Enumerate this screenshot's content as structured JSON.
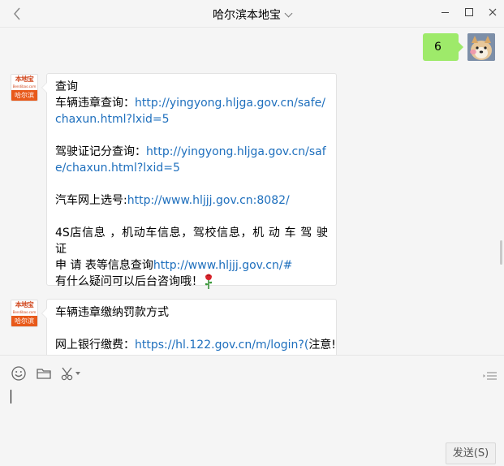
{
  "window": {
    "title": "哈尔滨本地宝"
  },
  "my_message": {
    "text": "6"
  },
  "bot": {
    "avatar_logo_text": "本地宝",
    "avatar_sub_text": "Bendibao.com",
    "avatar_city": "哈尔滨"
  },
  "messages": [
    {
      "heading": "查询",
      "violation_label": "车辆违章查询：",
      "violation_link": "http://yingyong.hljga.gov.cn/safe/chaxun.html?lxid=5",
      "license_label": "驾驶证记分查询：",
      "license_link": "http://yingyong.hljga.gov.cn/safe/chaxun.html?lxid=5",
      "plate_label": "汽车网上选号:",
      "plate_link": "http://www.hljjj.gov.cn:8082/",
      "info_line1": "4S店信息 ，机动车信息，驾校信息，机 动 车 驾 驶 证",
      "info_line2_text": "申 请 表等信息查询",
      "info_link": "http://www.hljjj.gov.cn/#",
      "closing": "有什么疑问可以后台咨询哦！"
    },
    {
      "heading": "车辆违章缴纳罚款方式",
      "bank_label": "网上银行缴费：",
      "bank_link": "https://hl.122.gov.cn/m/login?(",
      "bank_note": "注意!"
    }
  ],
  "composer": {
    "send_label": "发送(S)"
  },
  "icons": {
    "back": "chevron-left-icon",
    "emoji": "smiley-icon",
    "folder": "folder-icon",
    "scissors": "scissors-icon",
    "history": "chat-history-icon",
    "rose": "rose-icon"
  },
  "colors": {
    "my_bubble": "#9eea6a",
    "link": "#1e6fbd",
    "avatar_orange": "#e8591a"
  }
}
